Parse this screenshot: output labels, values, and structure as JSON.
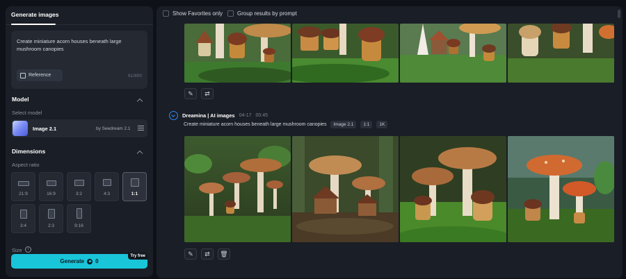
{
  "left_panel": {
    "tab_label": "Generate images",
    "prompt": {
      "text": "Create miniature acorn houses beneath large mushroom canopies",
      "reference_label": "Reference",
      "char_count": "61/800"
    },
    "model": {
      "title": "Model",
      "select_label": "Select model",
      "name": "Image 2.1",
      "provider": "by Seedream 2.1"
    },
    "dimensions": {
      "title": "Dimensions",
      "aspect_label": "Aspect ratio",
      "ratios": [
        {
          "label": "21:9",
          "selected": false
        },
        {
          "label": "16:9",
          "selected": false
        },
        {
          "label": "3:2",
          "selected": false
        },
        {
          "label": "4:3",
          "selected": false
        },
        {
          "label": "1:1",
          "selected": true
        },
        {
          "label": "3:4",
          "selected": false
        },
        {
          "label": "2:3",
          "selected": false
        },
        {
          "label": "9:16",
          "selected": false
        }
      ],
      "size_label": "Size",
      "info_glyph": "i"
    },
    "generate": {
      "label": "Generate",
      "cost": "0",
      "badge": "Try free"
    }
  },
  "right_panel": {
    "filters": {
      "favorites_label": "Show Favorites only",
      "group_label": "Group results by prompt"
    },
    "generation": {
      "source": "Dreamina | AI images",
      "date": "04-17",
      "time": "00:45",
      "prompt": "Create miniature acorn houses beneath large mushroom canopies",
      "tags": [
        "Image 2.1",
        "1:1",
        "1K"
      ]
    }
  },
  "colors": {
    "accent": "#19c5d9",
    "brand_blue": "#2f89f5",
    "panel_bg": "#1a1e26",
    "page_bg": "#0e1117"
  },
  "icons": {
    "reference": "image-reference-icon",
    "tune": "sliders-icon",
    "coin": "credit-coin-icon",
    "edit": "pencil-icon",
    "regenerate": "refresh-icon",
    "delete": "trash-icon",
    "brand": "dreamina-logo-icon"
  }
}
